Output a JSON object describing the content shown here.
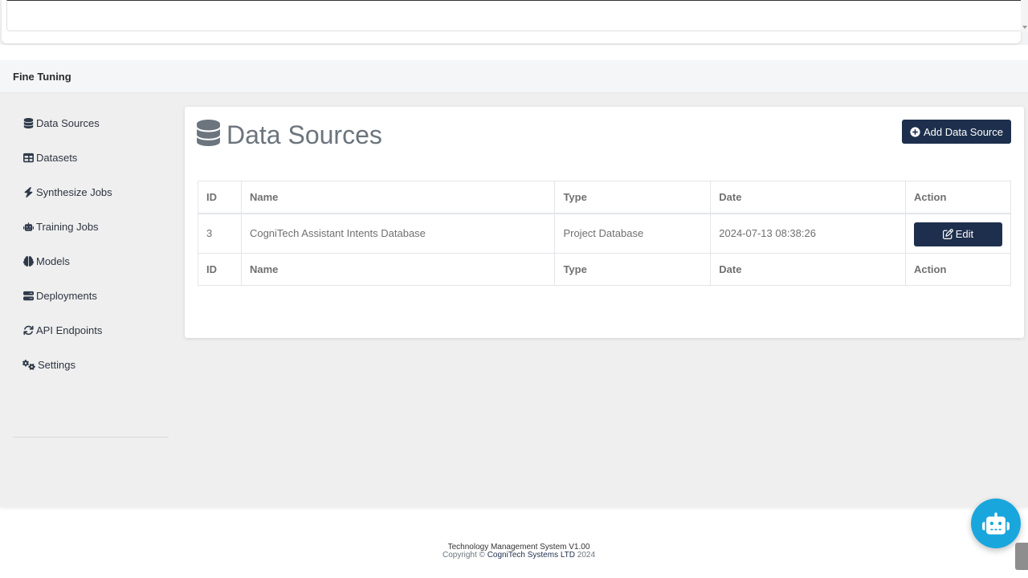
{
  "panel": {
    "title": "Fine Tuning"
  },
  "sidebar": {
    "items": [
      {
        "label": "Data Sources",
        "icon": "database-icon"
      },
      {
        "label": "Datasets",
        "icon": "table-icon"
      },
      {
        "label": "Synthesize Jobs",
        "icon": "bolt-icon"
      },
      {
        "label": "Training Jobs",
        "icon": "robot-icon"
      },
      {
        "label": "Models",
        "icon": "brain-icon"
      },
      {
        "label": "Deployments",
        "icon": "server-icon"
      },
      {
        "label": "API Endpoints",
        "icon": "sync-icon"
      },
      {
        "label": "Settings",
        "icon": "gears-icon"
      }
    ]
  },
  "card": {
    "title": "Data Sources",
    "add_button": "Add Data Source",
    "columns": [
      "ID",
      "Name",
      "Type",
      "Date",
      "Action"
    ],
    "rows": [
      {
        "id": "3",
        "name": "CogniTech Assistant Intents Database",
        "type": "Project Database",
        "date": "2024-07-13 08:38:26",
        "action": "Edit"
      }
    ],
    "footer_columns": [
      "ID",
      "Name",
      "Type",
      "Date",
      "Action"
    ]
  },
  "footer": {
    "line1": "Technology Management System V1.00",
    "copyright_prefix": "Copyright © ",
    "company": "CogniTech Systems LTD",
    "year": " 2024"
  },
  "colors": {
    "primary": "#1e2f4d",
    "fab": "#19a6dd",
    "muted_text": "#6c757d"
  }
}
